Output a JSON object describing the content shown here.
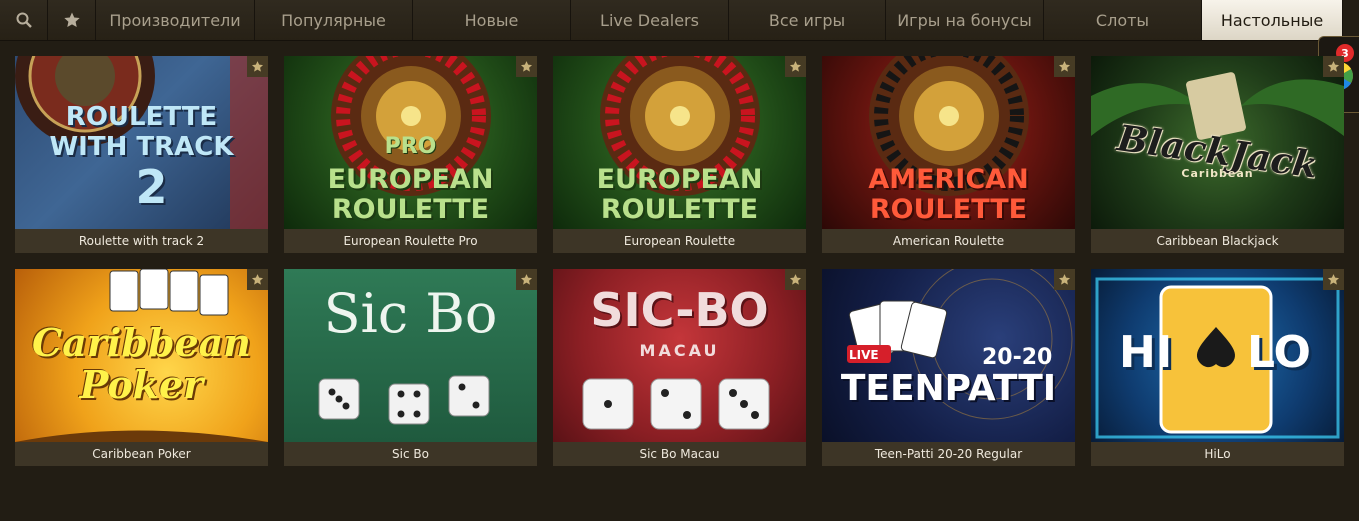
{
  "tabs": [
    {
      "label": "Производители"
    },
    {
      "label": "Популярные"
    },
    {
      "label": "Новые"
    },
    {
      "label": "Live Dealers"
    },
    {
      "label": "Все игры"
    },
    {
      "label": "Игры на бонусы"
    },
    {
      "label": "Слоты"
    },
    {
      "label": "Настольные",
      "active": true
    }
  ],
  "games": [
    {
      "name": "Roulette with track 2",
      "art": [
        "ROULETTE",
        "WITH TRACK",
        "2"
      ]
    },
    {
      "name": "European Roulette Pro",
      "art": [
        "PRO",
        "EUROPEAN",
        "ROULETTE"
      ]
    },
    {
      "name": "European Roulette",
      "art": [
        "EUROPEAN",
        "ROULETTE"
      ]
    },
    {
      "name": "American Roulette",
      "art": [
        "AMERICAN",
        "ROULETTE"
      ]
    },
    {
      "name": "Caribbean Blackjack",
      "art": [
        "BlackJack",
        "Caribbean"
      ]
    },
    {
      "name": "Caribbean Poker",
      "art": [
        "Caribbean",
        "Poker"
      ]
    },
    {
      "name": "Sic Bo",
      "art": [
        "Sic Bo"
      ]
    },
    {
      "name": "Sic Bo Macau",
      "art": [
        "SIC-BO",
        "MACAU"
      ]
    },
    {
      "name": "Teen-Patti 20-20 Regular",
      "art": [
        "LIVE",
        "20-20",
        "TEENPATTI"
      ]
    },
    {
      "name": "HiLo",
      "art": [
        "HI",
        "LO"
      ]
    }
  ],
  "wheel_badge": {
    "count": "3"
  },
  "colors": {
    "accent": "#f7f3ea",
    "card": "#3d3526",
    "background": "#221d14"
  }
}
